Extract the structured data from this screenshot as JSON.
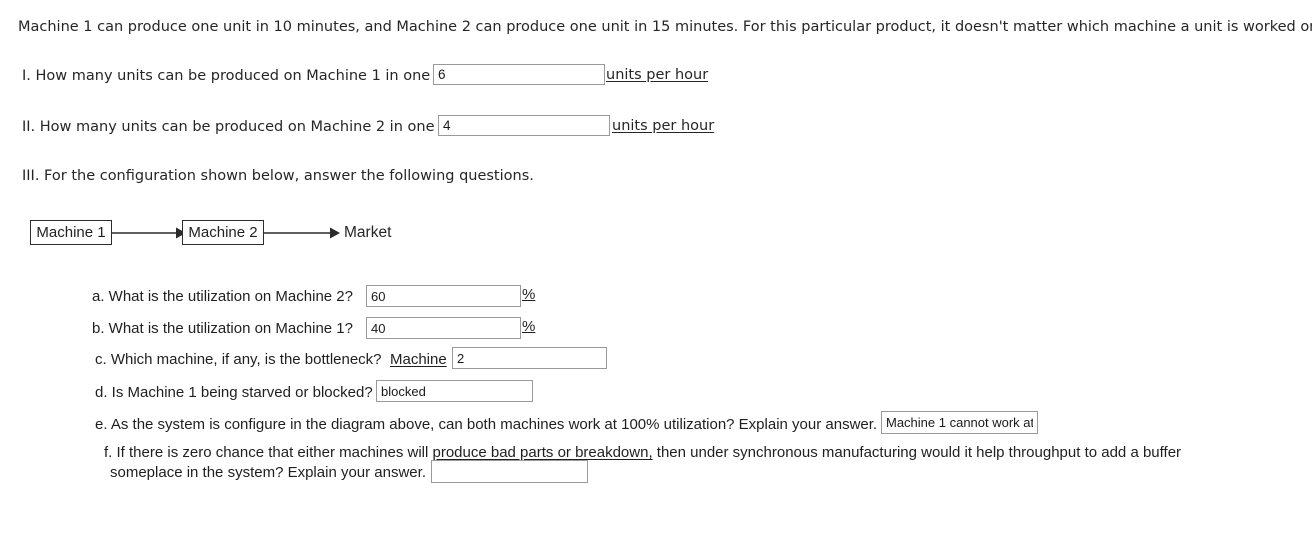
{
  "intro": {
    "text": "Machine 1 can produce one unit in 10 minutes, and Machine 2 can produce one unit in 15 minutes.  For this particular product, it doesn't matter which machine a unit is worked on first."
  },
  "question_1": {
    "prompt": "I. How many units can be produced on Machine 1 in one hour?",
    "answer": "6",
    "unit": "units per hour"
  },
  "question_2": {
    "prompt": "II. How many units can be produced on Machine 2 in one hour?",
    "answer": "4",
    "unit": "units per hour"
  },
  "question_3": {
    "prompt": "III. For the configuration shown below, answer the following questions."
  },
  "diagram": {
    "node_1": "Machine 1",
    "node_2": "Machine 2",
    "node_3": "Market"
  },
  "subquestions": {
    "a": {
      "prompt": "a. What is the utilization on Machine 2?",
      "answer": "60",
      "suffix": "%"
    },
    "b": {
      "prompt": "b. What is the utilization on Machine 1?",
      "answer": "40",
      "suffix": "%"
    },
    "c": {
      "prompt": "c. Which machine, if any, is the bottleneck?",
      "inline_label": "Machine",
      "answer": "2"
    },
    "d": {
      "prompt": "d. Is Machine 1 being starved or blocked?",
      "answer": "blocked"
    },
    "e": {
      "prompt": "e. As the system is configure in the diagram above, can both machines work at 100% utilization? Explain your answer.",
      "answer": "Machine 1 cannot work at"
    },
    "f": {
      "prompt_line1_pre": "f. If there is zero chance that either machines will ",
      "prompt_line1_underlined": "produce bad parts or breakdown,",
      "prompt_line1_post": " then under synchronous manufacturing would it help throughput to add a buffer",
      "prompt_line2": "someplace in the system?  Explain your answer.",
      "answer": ""
    }
  }
}
